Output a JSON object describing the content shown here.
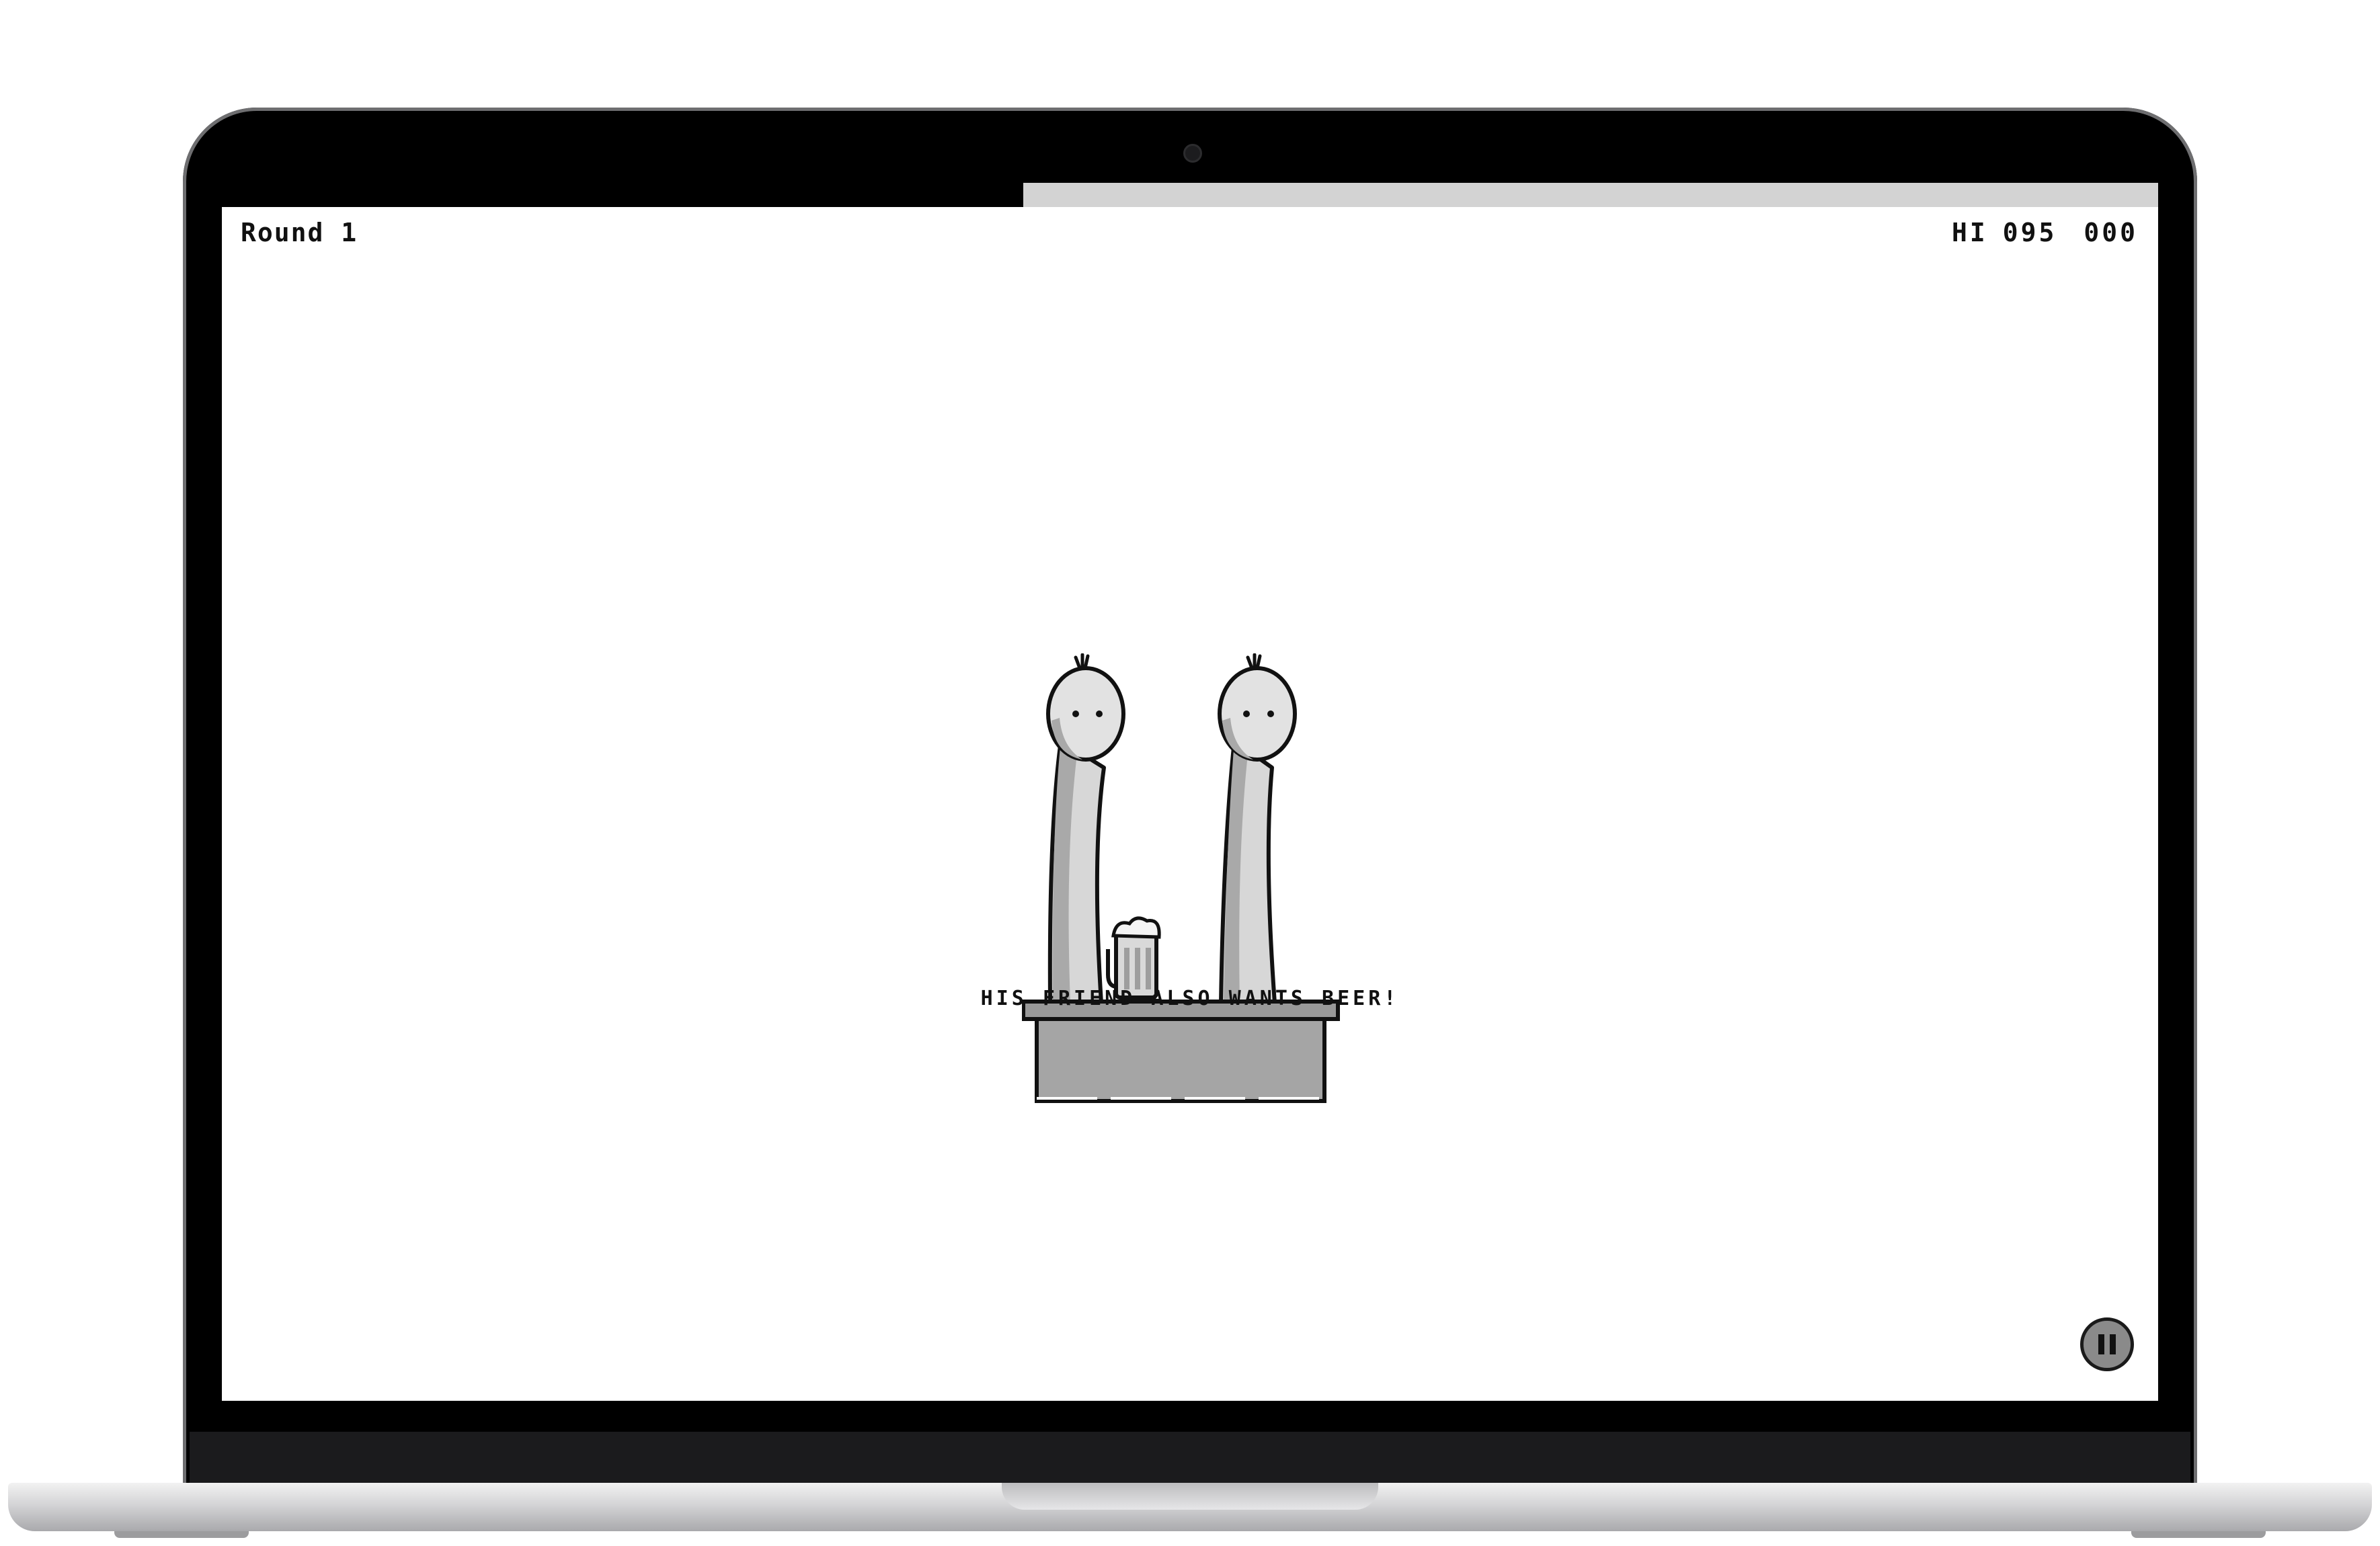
{
  "hud": {
    "round_label": "Round 1",
    "hi_label": "HI",
    "hi_score": "095",
    "score": "000"
  },
  "timer": {
    "remaining_fraction": 0.586
  },
  "scene": {
    "message": "HIS FRIEND ALSO WANTS BEER!"
  },
  "controls": {
    "pause_icon": "pause-icon"
  },
  "colors": {
    "bezel": "#000000",
    "screen_bg": "#ffffff",
    "timer_fill": "#d3d3d3",
    "character_gray": "#d6d6d6",
    "counter_gray": "#a5a5a5"
  }
}
